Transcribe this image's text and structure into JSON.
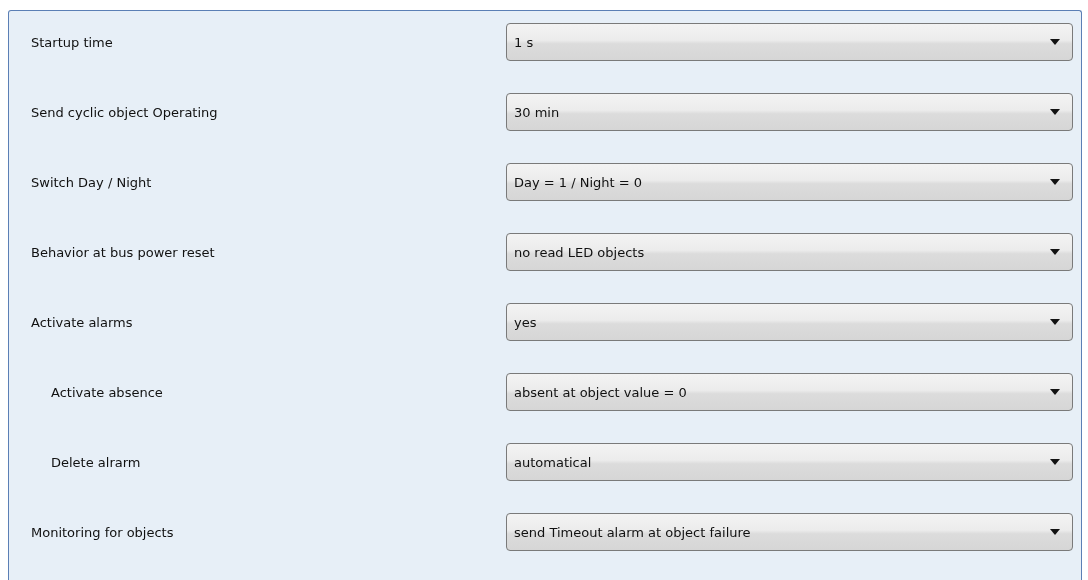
{
  "parameters": [
    {
      "label": "Startup time",
      "value": "1 s"
    },
    {
      "label": "Send cyclic object Operating",
      "value": "30 min"
    },
    {
      "label": "Switch Day / Night",
      "value": "Day = 1 / Night = 0"
    },
    {
      "label": "Behavior at bus power reset",
      "value": "no read LED objects"
    },
    {
      "label": "Activate alarms",
      "value": "yes",
      "children": [
        {
          "label": "Activate absence",
          "value": "absent at object value = 0"
        },
        {
          "label": "Delete alrarm",
          "value": "automatical"
        }
      ]
    },
    {
      "label": "Monitoring for objects",
      "value": "send Timeout alarm at object failure"
    }
  ]
}
